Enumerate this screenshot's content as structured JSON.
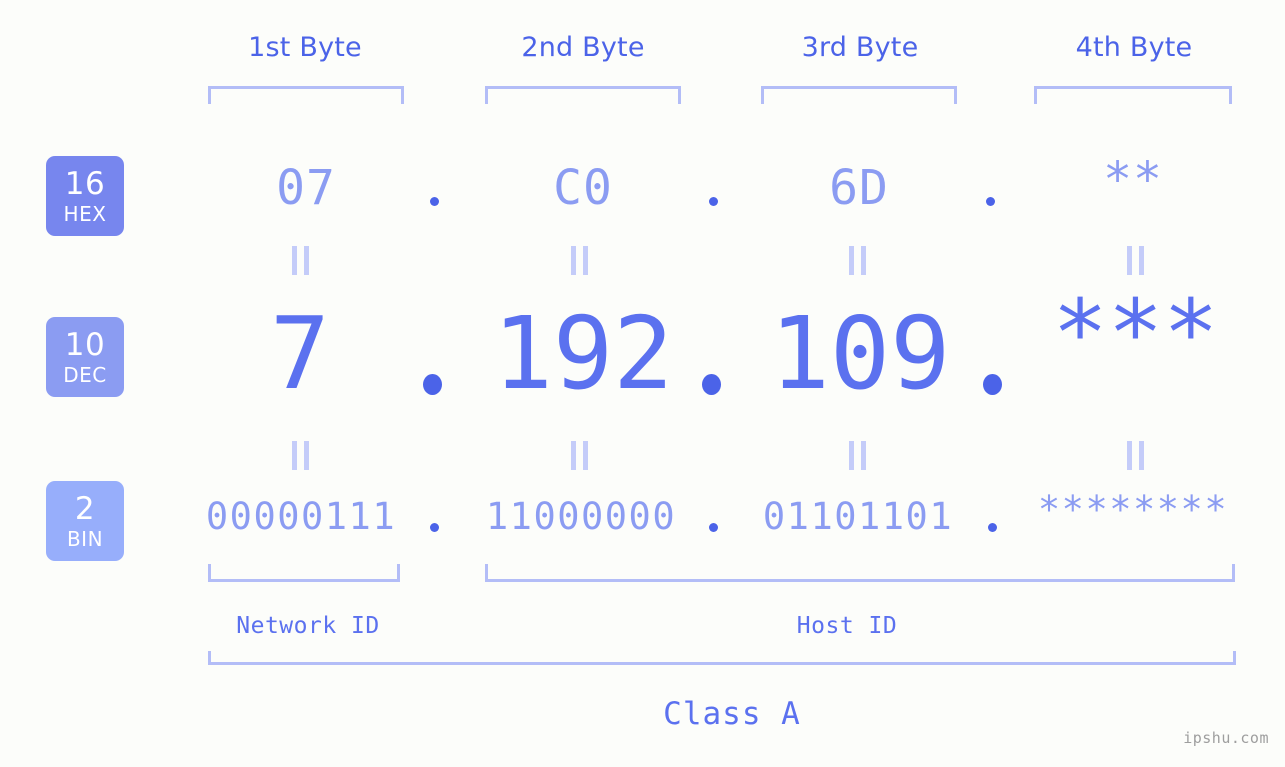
{
  "background_color": "#fcfdfa",
  "accent": {
    "strong": "#4b63e8",
    "mid": "#5b71ef",
    "soft": "#8b9cf2",
    "pale": "#b3bdf7",
    "faint": "#c4ccf9"
  },
  "byte_headers": [
    {
      "label": "1st Byte"
    },
    {
      "label": "2nd Byte"
    },
    {
      "label": "3rd Byte"
    },
    {
      "label": "4th Byte"
    }
  ],
  "rows": [
    {
      "base_number": "16",
      "base_abbr": "HEX",
      "badge_color": "#7786ee",
      "values": [
        "07",
        "C0",
        "6D",
        "**"
      ],
      "separator": "."
    },
    {
      "base_number": "10",
      "base_abbr": "DEC",
      "badge_color": "#8b9cf2",
      "values": [
        "7",
        "192",
        "109",
        "***"
      ],
      "separator": "."
    },
    {
      "base_number": "2",
      "base_abbr": "BIN",
      "badge_color": "#97aefb",
      "values": [
        "00000111",
        "11000000",
        "01101101",
        "********"
      ],
      "separator": "."
    }
  ],
  "equality_marks": {
    "glyph": "||",
    "count_per_row_gap": 4
  },
  "id_sections": [
    {
      "label": "Network ID"
    },
    {
      "label": "Host ID"
    }
  ],
  "class": {
    "label": "Class A"
  },
  "watermark": {
    "text": "ipshu.com"
  }
}
